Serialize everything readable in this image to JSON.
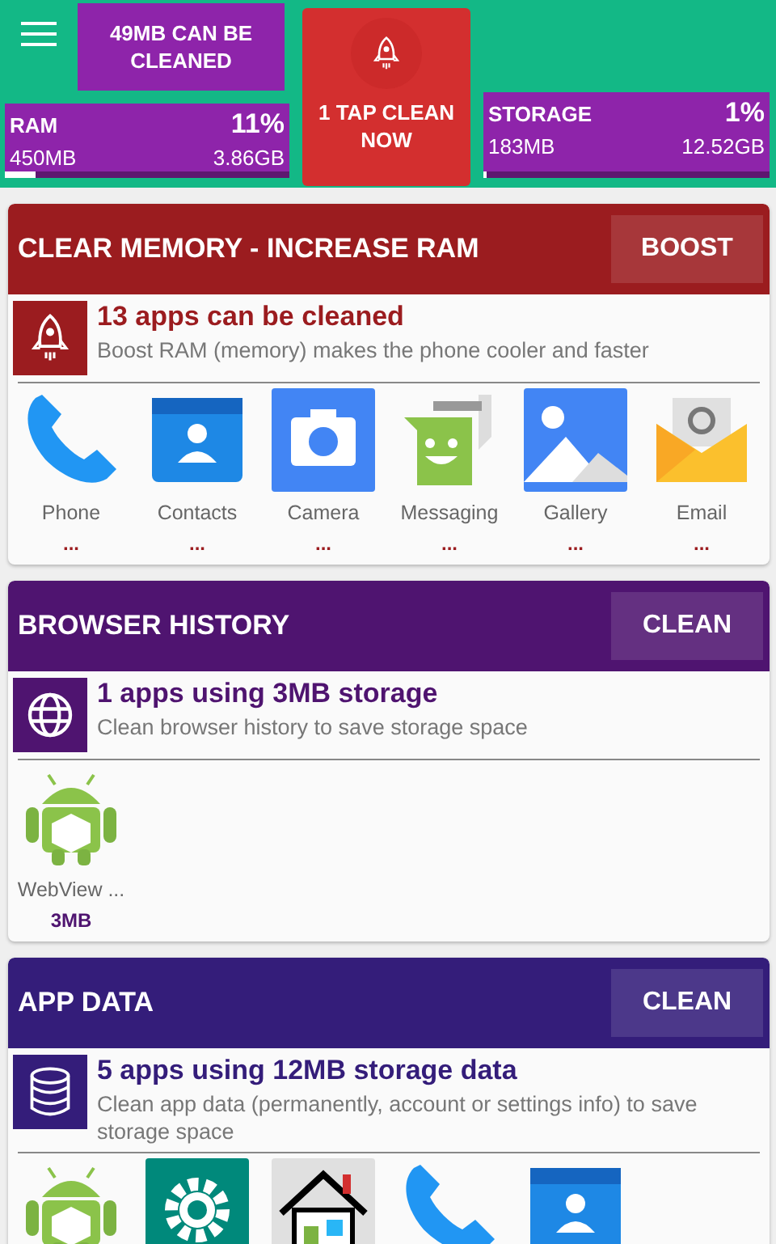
{
  "header": {
    "cleanable": "49MB CAN BE CLEANED",
    "tap_button": "1 TAP CLEAN NOW",
    "meters": [
      {
        "label": "RAM",
        "percent": "11%",
        "used": "450MB",
        "total": "3.86GB",
        "level": 0.11
      },
      {
        "label": "STORAGE",
        "percent": "1%",
        "used": "183MB",
        "total": "12.52GB",
        "level": 0.01
      }
    ]
  },
  "sections": [
    {
      "kind": "rocket",
      "color": "#9b1c1f",
      "title": "CLEAR MEMORY - INCREASE RAM",
      "button": "BOOST",
      "headline": "13 apps can be cleaned",
      "description": "Boost RAM (memory) makes the phone cooler and faster",
      "apps": [
        {
          "kind": "phone",
          "name": "Phone",
          "size": "..."
        },
        {
          "kind": "contacts",
          "name": "Contacts",
          "size": "..."
        },
        {
          "kind": "camera",
          "name": "Camera",
          "size": "..."
        },
        {
          "kind": "messaging",
          "name": "Messaging",
          "size": "..."
        },
        {
          "kind": "gallery",
          "name": "Gallery",
          "size": "..."
        },
        {
          "kind": "email",
          "name": "Email",
          "size": "..."
        }
      ]
    },
    {
      "kind": "globe",
      "color": "#4f1470",
      "title": "BROWSER HISTORY",
      "button": "CLEAN",
      "headline": "1 apps using 3MB storage",
      "description": "Clean browser history to save storage space",
      "apps": [
        {
          "kind": "android",
          "name": "WebView ...",
          "size": "3MB"
        }
      ]
    },
    {
      "kind": "database",
      "color": "#341d7a",
      "title": "APP DATA",
      "button": "CLEAN",
      "headline": "5 apps using 12MB storage data",
      "description": "Clean app data (permanently, account or settings info) to save storage space",
      "apps": [
        {
          "kind": "android"
        },
        {
          "kind": "settings"
        },
        {
          "kind": "home"
        },
        {
          "kind": "phone"
        },
        {
          "kind": "contacts"
        }
      ]
    }
  ]
}
